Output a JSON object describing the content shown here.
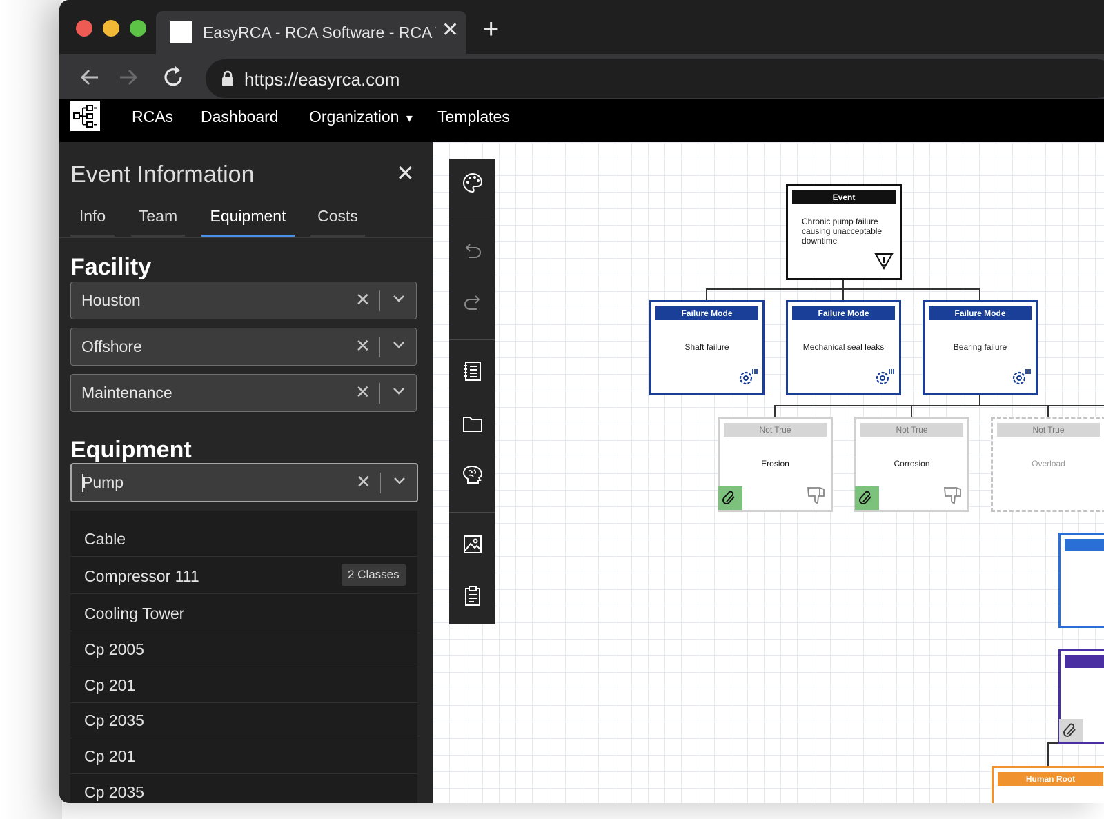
{
  "browser": {
    "tab_title": "EasyRCA - RCA Software - RCA Tool",
    "tab_close": "✕",
    "new_tab": "+",
    "url": "https://easyrca.com"
  },
  "app_nav": {
    "items": [
      "RCAs",
      "Dashboard",
      "Organization",
      "Templates"
    ],
    "org_caret": "▾"
  },
  "panel": {
    "title": "Event Information",
    "close": "✕",
    "tabs": [
      "Info",
      "Team",
      "Equipment",
      "Costs"
    ],
    "active_tab": "Equipment",
    "facility_label": "Facility",
    "facility_values": [
      "Houston",
      "Offshore",
      "Maintenance"
    ],
    "equipment_label": "Equipment",
    "equipment_value": "Pump",
    "clear_glyph": "✕",
    "options": [
      {
        "label": "Cable"
      },
      {
        "label": "Compressor 111",
        "badge": "2 Classes"
      },
      {
        "label": "Cooling Tower"
      },
      {
        "label": "Cp 2005"
      },
      {
        "label": "Cp 201"
      },
      {
        "label": "Cp 2035"
      },
      {
        "label": "Cp 201"
      },
      {
        "label": "Cp 2035"
      }
    ]
  },
  "diagram": {
    "event": {
      "header": "Event",
      "text": "Chronic pump failure causing unacceptable downtime"
    },
    "failure_modes": [
      {
        "header": "Failure Mode",
        "text": "Shaft failure"
      },
      {
        "header": "Failure Mode",
        "text": "Mechanical seal leaks"
      },
      {
        "header": "Failure Mode",
        "text": "Bearing failure"
      }
    ],
    "hypotheses": [
      {
        "header": "Not True",
        "text": "Erosion"
      },
      {
        "header": "Not True",
        "text": "Corrosion"
      },
      {
        "header": "Not True",
        "text": "Overload"
      }
    ],
    "human_root": {
      "header": "Human Root"
    }
  },
  "colors": {
    "failure_mode_blue": "#1a3f99",
    "hypothesis_gray": "#d6d6d6",
    "evidence_green": "#7cc27c",
    "human_root_orange": "#f0922e",
    "physical_root_blue": "#2a6fd6",
    "latent_root_purple": "#4a2fa3",
    "tab_accent": "#4a8fe8"
  }
}
